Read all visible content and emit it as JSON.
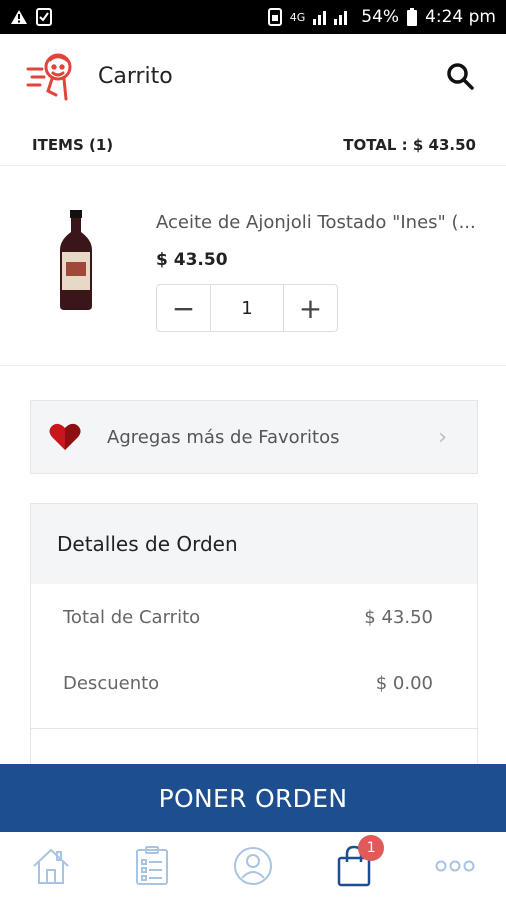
{
  "status": {
    "network": "4G",
    "battery": "54%",
    "time": "4:24 pm"
  },
  "header": {
    "title": "Carrito"
  },
  "summary": {
    "items": "ITEMS (1)",
    "total": "TOTAL : $ 43.50"
  },
  "cart_item": {
    "name": "Aceite de Ajonjoli Tostado \"Ines\" (...",
    "price": "$ 43.50",
    "quantity": "1",
    "minus": "−",
    "plus": "+"
  },
  "favorites": {
    "label": "Agregas más de Favoritos",
    "chevron": "›"
  },
  "order": {
    "title": "Detalles de Orden",
    "rows": [
      {
        "label": "Total de Carrito",
        "value": "$ 43.50"
      },
      {
        "label": "Descuento",
        "value": "$ 0.00"
      }
    ]
  },
  "place_order": {
    "label": "PONER ORDEN"
  },
  "bottom_nav": {
    "cart_badge": "1"
  },
  "colors": {
    "primary": "#1d4e8f",
    "accent_red": "#e0443a",
    "badge": "#e05a5a",
    "nav_icon": "#a8c4e4"
  }
}
